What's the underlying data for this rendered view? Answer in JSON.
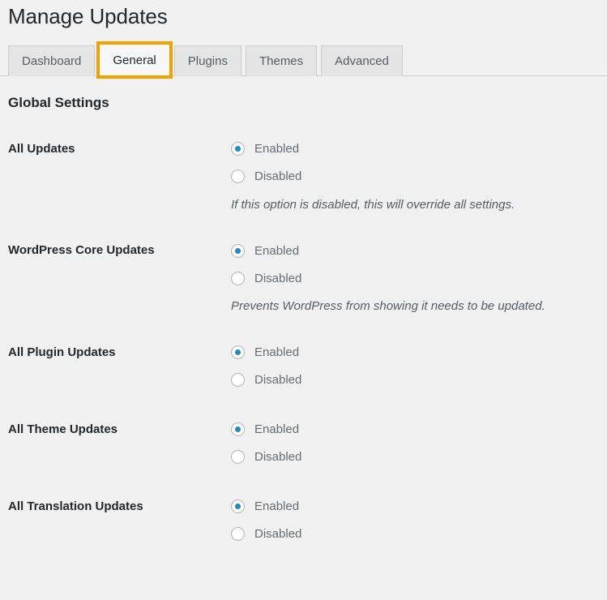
{
  "header": {
    "title": "Manage Updates"
  },
  "tabs": {
    "items": [
      {
        "label": "Dashboard",
        "active": false,
        "focused": false
      },
      {
        "label": "General",
        "active": true,
        "focused": true
      },
      {
        "label": "Plugins",
        "active": false,
        "focused": false
      },
      {
        "label": "Themes",
        "active": false,
        "focused": false
      },
      {
        "label": "Advanced",
        "active": false,
        "focused": false
      }
    ]
  },
  "main": {
    "section_heading": "Global Settings",
    "settings": [
      {
        "label": "All Updates",
        "options": [
          {
            "label": "Enabled",
            "checked": true
          },
          {
            "label": "Disabled",
            "checked": false
          }
        ],
        "description": "If this option is disabled, this will override all settings."
      },
      {
        "label": "WordPress Core Updates",
        "options": [
          {
            "label": "Enabled",
            "checked": true
          },
          {
            "label": "Disabled",
            "checked": false
          }
        ],
        "description": "Prevents WordPress from showing it needs to be updated."
      },
      {
        "label": "All Plugin Updates",
        "options": [
          {
            "label": "Enabled",
            "checked": true
          },
          {
            "label": "Disabled",
            "checked": false
          }
        ],
        "description": ""
      },
      {
        "label": "All Theme Updates",
        "options": [
          {
            "label": "Enabled",
            "checked": true
          },
          {
            "label": "Disabled",
            "checked": false
          }
        ],
        "description": ""
      },
      {
        "label": "All Translation Updates",
        "options": [
          {
            "label": "Enabled",
            "checked": true
          },
          {
            "label": "Disabled",
            "checked": false
          }
        ],
        "description": ""
      }
    ]
  },
  "colors": {
    "page_background": "#f1f1f1",
    "heading": "#23282d",
    "radio_accent": "#1e8cbe",
    "focus_ring": "#f0a202",
    "tab_inactive_background": "#e5e5e5",
    "tab_active_background": "#f7f7f7",
    "border": "#cccccc"
  }
}
